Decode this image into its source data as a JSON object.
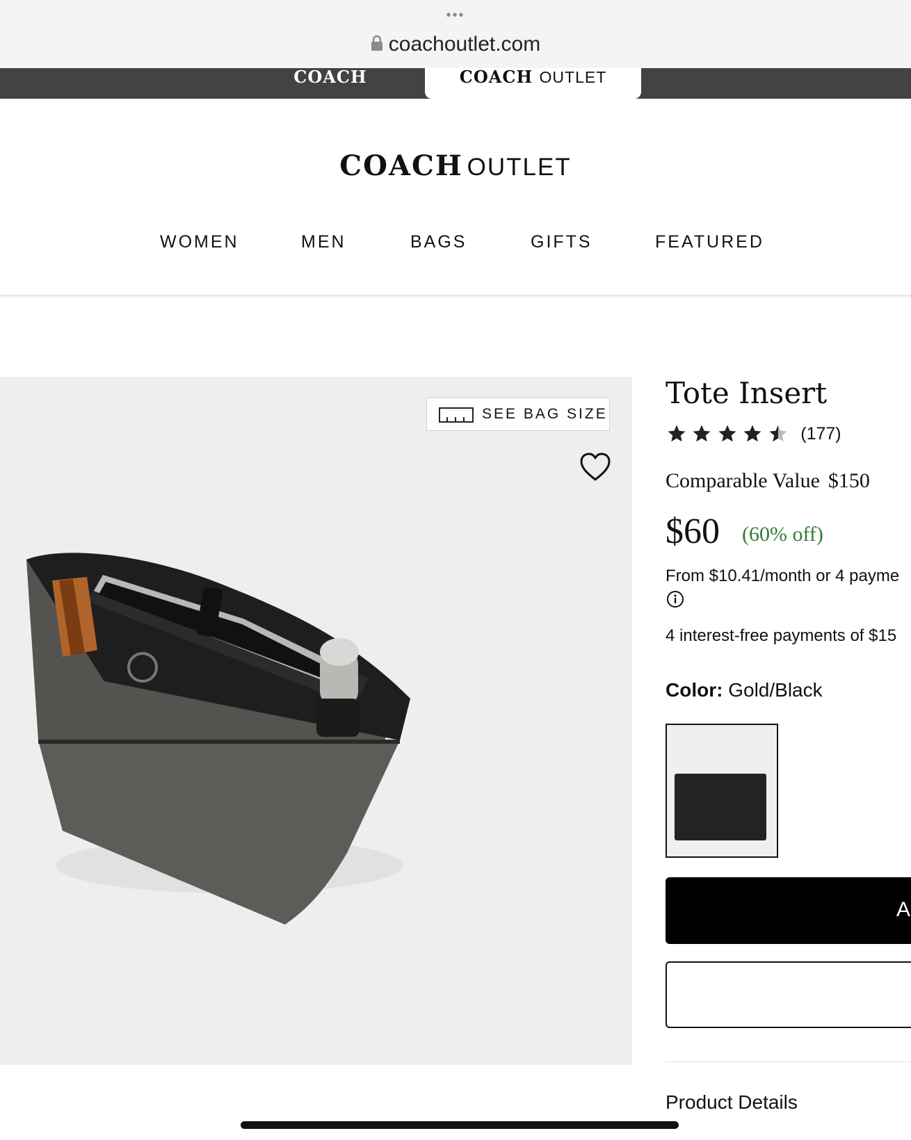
{
  "browser": {
    "more_glyph": "•••",
    "url": "coachoutlet.com"
  },
  "brand_tabs": {
    "coach": "COACH",
    "outlet_word1": "COACH",
    "outlet_word2": "OUTLET"
  },
  "header": {
    "logo_word1": "COACH",
    "logo_word2": "OUTLET"
  },
  "nav": {
    "items": [
      {
        "label": "WOMEN"
      },
      {
        "label": "MEN"
      },
      {
        "label": "BAGS"
      },
      {
        "label": "GIFTS"
      },
      {
        "label": "FEATURED"
      }
    ]
  },
  "gallery": {
    "see_bag_size_label": "SEE BAG SIZE",
    "ruler_icon": "ruler-icon",
    "heart_icon": "heart-icon"
  },
  "product": {
    "name": "Tote Insert",
    "rating": 4.5,
    "review_count": "(177)",
    "comparable_label": "Comparable Value",
    "comparable_value": "$150",
    "price": "$60",
    "discount": "(60% off)",
    "installment_text": "From $10.41/month or 4 payme",
    "interest_free_text": "4 interest-free payments of $15",
    "color_label": "Color:",
    "color_value": "Gold/Black",
    "add_button_label": "A",
    "details_label": "Product Details"
  },
  "colors": {
    "discount_green": "#2e7d32",
    "brand_bar": "#434343",
    "image_bg": "#efeeee"
  }
}
